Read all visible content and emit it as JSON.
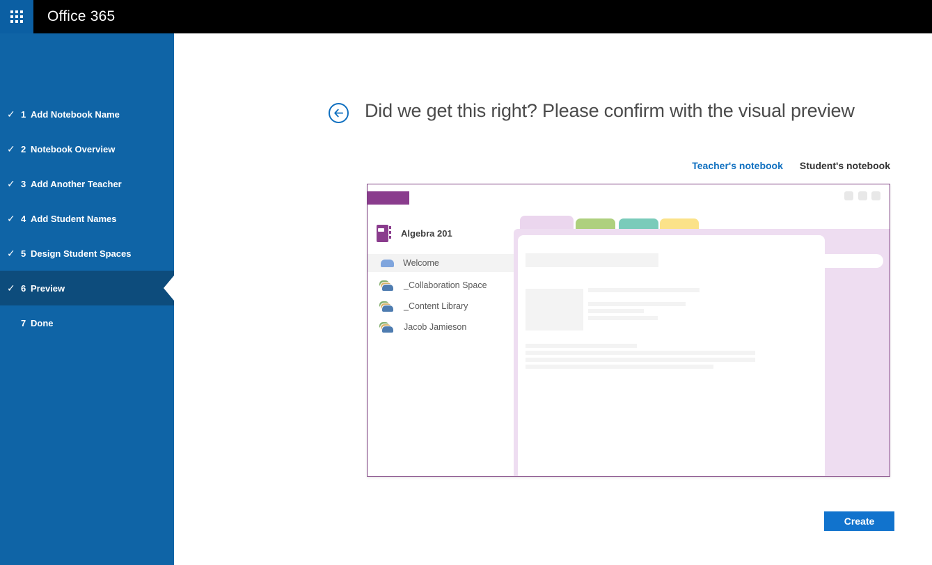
{
  "top_bar": {
    "app_name": "Office 365"
  },
  "wizard_steps": {
    "items": [
      {
        "number": "1",
        "label": "Add Notebook Name",
        "completed": true,
        "active": false
      },
      {
        "number": "2",
        "label": "Notebook Overview",
        "completed": true,
        "active": false
      },
      {
        "number": "3",
        "label": "Add Another Teacher",
        "completed": true,
        "active": false
      },
      {
        "number": "4",
        "label": "Add Student Names",
        "completed": true,
        "active": false
      },
      {
        "number": "5",
        "label": "Design Student Spaces",
        "completed": true,
        "active": false
      },
      {
        "number": "6",
        "label": "Preview",
        "completed": true,
        "active": true
      },
      {
        "number": "7",
        "label": "Done",
        "completed": false,
        "active": false
      }
    ],
    "check_glyph": "✓"
  },
  "header": {
    "title": "Did we get this right? Please confirm with the visual preview"
  },
  "preview_tabs": {
    "teacher_label": "Teacher's notebook",
    "student_label": "Student's notebook",
    "active": "Teacher's notebook"
  },
  "notebook_preview": {
    "notebook_name": "Algebra 201",
    "sections": [
      {
        "label": "Welcome",
        "type": "section",
        "selected": true
      },
      {
        "label": "_Collaboration Space",
        "type": "section-group",
        "selected": false
      },
      {
        "label": "_Content Library",
        "type": "section-group",
        "selected": false
      },
      {
        "label": "Jacob Jamieson",
        "type": "section-group",
        "selected": false
      }
    ]
  },
  "actions": {
    "create_label": "Create"
  },
  "theme": {
    "suite-bar-bg": "#000000",
    "launcher-tile": "#0b5fa3",
    "sidebar-bg": "#0f64a6",
    "sidebar-active-bg": "#0d4c7c",
    "accent-blue": "#1070c0",
    "create-btn": "#1173cd",
    "panel-border": "#7c3e80",
    "brand-purple": "#8a3c8d",
    "tab-pink": "#ebd6ee",
    "body-pink": "#eeddf1",
    "tab-green": "#aed07e",
    "tab-teal": "#7acbba",
    "tab-yellow": "#fbe289",
    "icon-blue-light": "#7fa5dd",
    "icon-blue": "#4e7cb0",
    "icon-green": "#82ae6d",
    "icon-tan": "#d7b36e"
  }
}
